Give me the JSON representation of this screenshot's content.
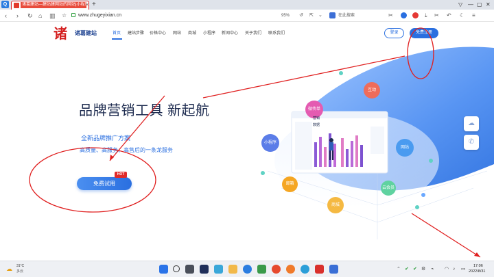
{
  "browser": {
    "app_icon": "browser-logo-icon",
    "tab_title": "诸葛建站—建站建网站的网站|小程序",
    "new_tab_label": "+",
    "url": "www.zhugeyixian.cn",
    "zoom": "95%",
    "search_placeholder": "在此搜索"
  },
  "site": {
    "logo_mark": "诸",
    "name": "诸葛建站",
    "nav": [
      "首页",
      "建站步骤",
      "价格中心",
      "网站",
      "商城",
      "小程序",
      "新闻中心",
      "关于我们",
      "联系我们"
    ],
    "login": "登录",
    "register": "免费注册"
  },
  "hero": {
    "title": "品牌营销工具 新起航",
    "subtitle": "全新品牌推广方案",
    "subtitle2": "高质量、高服务、高售后的一条龙服务",
    "trial": "免费试用",
    "hot": "HOT"
  },
  "bubbles": {
    "b1": "微传单",
    "b2": "互动",
    "b3": "小程序",
    "b4": "网站",
    "b5": "邮箱",
    "b6": "云会员",
    "b7": "商城"
  },
  "dashboard": {
    "title1": "营销",
    "title2": "数据"
  },
  "taskbar": {
    "temp": "31°C",
    "weather": "多云",
    "time": "17:06",
    "date": "2022/8/31"
  },
  "colors": {
    "accent": "#2a6fe0",
    "brand_red": "#d41f1f",
    "annotation_red": "#e02020"
  }
}
